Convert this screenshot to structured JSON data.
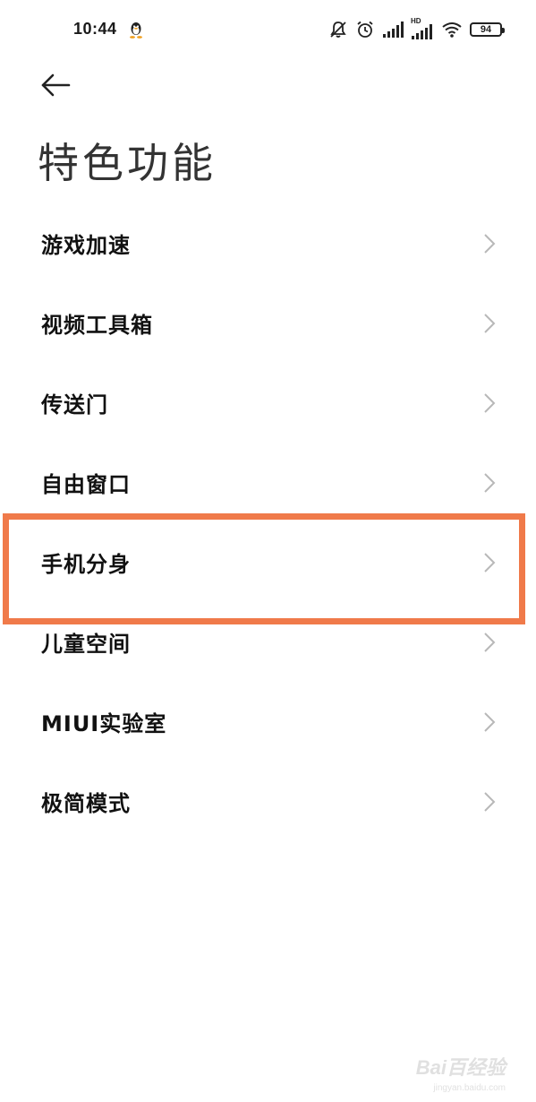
{
  "status_bar": {
    "time": "10:44",
    "battery_level": "94",
    "network_label": "HD"
  },
  "header": {
    "title": "特色功能"
  },
  "settings": {
    "items": [
      {
        "label": "游戏加速"
      },
      {
        "label": "视频工具箱"
      },
      {
        "label": "传送门"
      },
      {
        "label": "自由窗口"
      },
      {
        "label": "手机分身"
      },
      {
        "label": "儿童空间"
      },
      {
        "label": "MIUI实验室"
      },
      {
        "label": "极简模式"
      }
    ],
    "highlighted_index": 4
  },
  "watermark": {
    "logo": "Bai百经验",
    "site": "jingyan.baidu.com"
  },
  "colors": {
    "highlight": "#f07a4a",
    "title": "#333333",
    "item_text": "#111111",
    "chevron": "#b8b8b8"
  }
}
